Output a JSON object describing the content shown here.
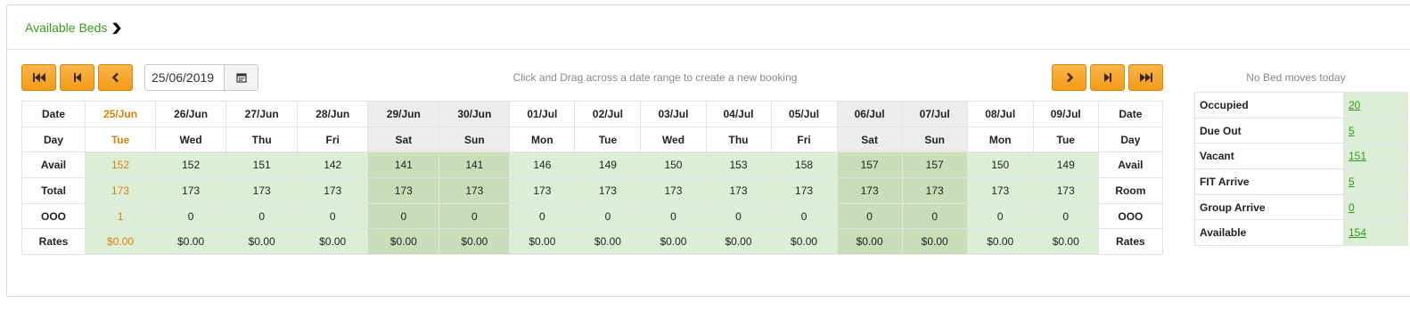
{
  "header": {
    "title": "Available Beds"
  },
  "nav": {
    "date_value": "25/06/2019",
    "hint": "Click and Drag across a date range to create a new booking",
    "no_moves": "No Bed moves today"
  },
  "colors": {
    "accent": "#f5a623",
    "title_green": "#3c9a1e",
    "today_orange": "#d9820b",
    "avail_green": "#dcefd6",
    "weekend_green": "#c8ddb8"
  },
  "grid": {
    "left_labels": [
      "Date",
      "Day",
      "Avail",
      "Total",
      "OOO",
      "Rates"
    ],
    "right_labels": [
      "Date",
      "Day",
      "Avail",
      "Room",
      "OOO",
      "Rates"
    ],
    "columns": [
      {
        "date": "25/Jun",
        "day": "Tue",
        "avail": "152",
        "total": "173",
        "ooo": "1",
        "rate": "$0.00",
        "weekend": false,
        "today": true
      },
      {
        "date": "26/Jun",
        "day": "Wed",
        "avail": "152",
        "total": "173",
        "ooo": "0",
        "rate": "$0.00",
        "weekend": false,
        "today": false
      },
      {
        "date": "27/Jun",
        "day": "Thu",
        "avail": "151",
        "total": "173",
        "ooo": "0",
        "rate": "$0.00",
        "weekend": false,
        "today": false
      },
      {
        "date": "28/Jun",
        "day": "Fri",
        "avail": "142",
        "total": "173",
        "ooo": "0",
        "rate": "$0.00",
        "weekend": false,
        "today": false
      },
      {
        "date": "29/Jun",
        "day": "Sat",
        "avail": "141",
        "total": "173",
        "ooo": "0",
        "rate": "$0.00",
        "weekend": true,
        "today": false
      },
      {
        "date": "30/Jun",
        "day": "Sun",
        "avail": "141",
        "total": "173",
        "ooo": "0",
        "rate": "$0.00",
        "weekend": true,
        "today": false
      },
      {
        "date": "01/Jul",
        "day": "Mon",
        "avail": "146",
        "total": "173",
        "ooo": "0",
        "rate": "$0.00",
        "weekend": false,
        "today": false
      },
      {
        "date": "02/Jul",
        "day": "Tue",
        "avail": "149",
        "total": "173",
        "ooo": "0",
        "rate": "$0.00",
        "weekend": false,
        "today": false
      },
      {
        "date": "03/Jul",
        "day": "Wed",
        "avail": "150",
        "total": "173",
        "ooo": "0",
        "rate": "$0.00",
        "weekend": false,
        "today": false
      },
      {
        "date": "04/Jul",
        "day": "Thu",
        "avail": "153",
        "total": "173",
        "ooo": "0",
        "rate": "$0.00",
        "weekend": false,
        "today": false
      },
      {
        "date": "05/Jul",
        "day": "Fri",
        "avail": "158",
        "total": "173",
        "ooo": "0",
        "rate": "$0.00",
        "weekend": false,
        "today": false
      },
      {
        "date": "06/Jul",
        "day": "Sat",
        "avail": "157",
        "total": "173",
        "ooo": "0",
        "rate": "$0.00",
        "weekend": true,
        "today": false
      },
      {
        "date": "07/Jul",
        "day": "Sun",
        "avail": "157",
        "total": "173",
        "ooo": "0",
        "rate": "$0.00",
        "weekend": true,
        "today": false
      },
      {
        "date": "08/Jul",
        "day": "Mon",
        "avail": "150",
        "total": "173",
        "ooo": "0",
        "rate": "$0.00",
        "weekend": false,
        "today": false
      },
      {
        "date": "09/Jul",
        "day": "Tue",
        "avail": "149",
        "total": "173",
        "ooo": "0",
        "rate": "$0.00",
        "weekend": false,
        "today": false
      }
    ]
  },
  "stats": [
    {
      "label": "Occupied",
      "value": "20"
    },
    {
      "label": "Due Out",
      "value": "5"
    },
    {
      "label": "Vacant",
      "value": "151"
    },
    {
      "label": "FIT Arrive",
      "value": "5"
    },
    {
      "label": "Group Arrive",
      "value": "0"
    },
    {
      "label": "Available",
      "value": "154"
    }
  ]
}
